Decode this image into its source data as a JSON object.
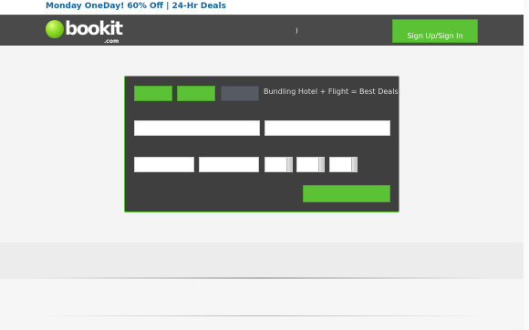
{
  "promo": {
    "text": "Monday OneDay! 60% Off | 24-Hr Deals"
  },
  "header": {
    "logo_text": "bookit",
    "logo_suffix": ".com",
    "logo_mark": "®",
    "nav_glyph": ")",
    "signup_label": "Sign Up/Sign In"
  },
  "search": {
    "bundle_text": "Bundling Hotel + Flight = Best Deals!"
  },
  "colors": {
    "brand_green": "#5bc236",
    "header_bg": "#4a4a4a",
    "panel_bg": "#3f3f3f",
    "inactive_tab": "#555a63",
    "promo_text": "#1565a5"
  }
}
